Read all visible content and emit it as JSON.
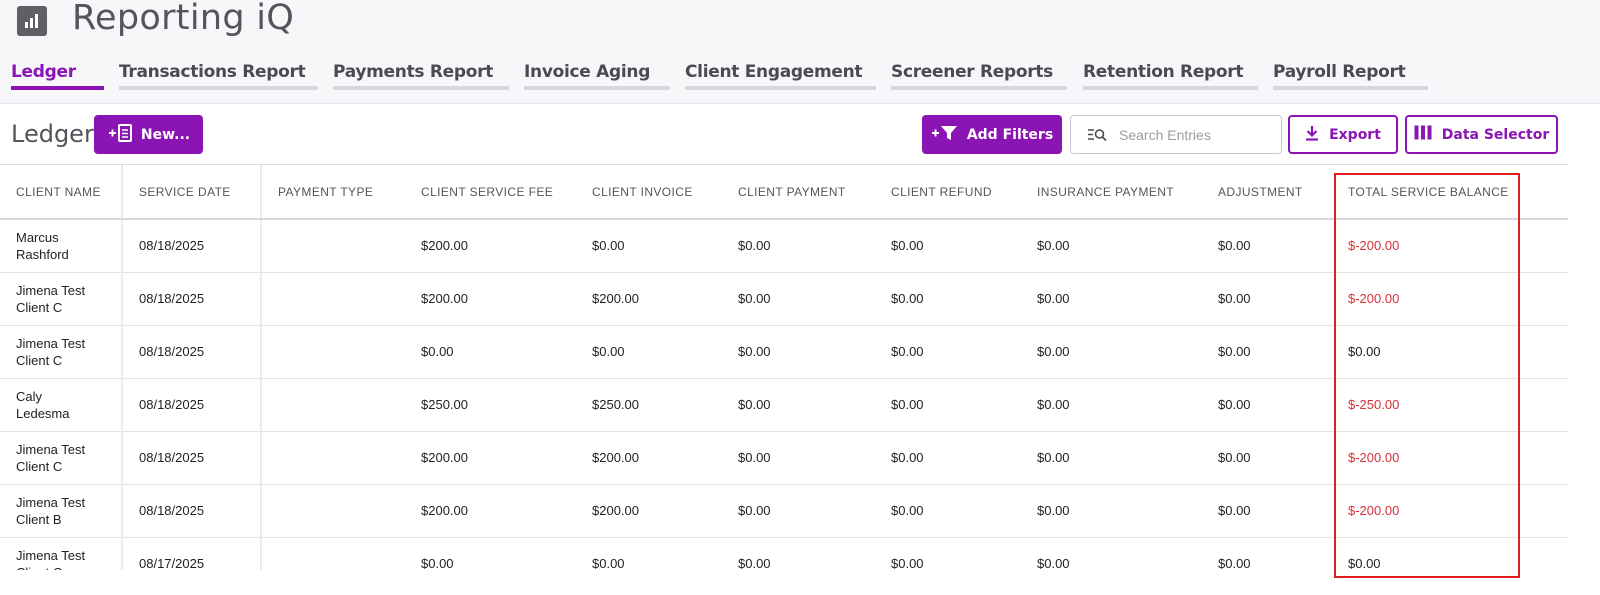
{
  "app": {
    "title": "Reporting iQ",
    "icon": "bar-chart-icon"
  },
  "tabs": [
    {
      "label": "Ledger",
      "active": true
    },
    {
      "label": "Transactions Report",
      "active": false
    },
    {
      "label": "Payments Report",
      "active": false
    },
    {
      "label": "Invoice Aging",
      "active": false
    },
    {
      "label": "Client Engagement",
      "active": false
    },
    {
      "label": "Screener Reports",
      "active": false
    },
    {
      "label": "Retention Report",
      "active": false
    },
    {
      "label": "Payroll Report",
      "active": false
    }
  ],
  "toolbar": {
    "title": "Ledger",
    "new_label": "New...",
    "new_icon": "plus-document-icon",
    "add_filters_label": "Add Filters",
    "add_filters_icon": "plus-filter-icon",
    "search_placeholder": "Search Entries",
    "search_value": "",
    "search_icon": "search-list-icon",
    "export_label": "Export",
    "export_icon": "download-icon",
    "data_selector_label": "Data Selector",
    "data_selector_icon": "columns-icon"
  },
  "table": {
    "columns": [
      "CLIENT NAME",
      "SERVICE DATE",
      "PAYMENT TYPE",
      "CLIENT SERVICE FEE",
      "CLIENT INVOICE",
      "CLIENT PAYMENT",
      "CLIENT REFUND",
      "INSURANCE PAYMENT",
      "ADJUSTMENT",
      "TOTAL SERVICE BALANCE"
    ],
    "rows": [
      {
        "client_line1": "Marcus",
        "client_line2": "Rashford",
        "service_date": "08/18/2025",
        "payment_type": "",
        "client_service_fee": "$200.00",
        "client_invoice": "$0.00",
        "client_payment": "$0.00",
        "client_refund": "$0.00",
        "insurance_payment": "$0.00",
        "adjustment": "$0.00",
        "total_service_balance": "$-200.00",
        "negative": true
      },
      {
        "client_line1": "Jimena Test",
        "client_line2": "Client C",
        "service_date": "08/18/2025",
        "payment_type": "",
        "client_service_fee": "$200.00",
        "client_invoice": "$200.00",
        "client_payment": "$0.00",
        "client_refund": "$0.00",
        "insurance_payment": "$0.00",
        "adjustment": "$0.00",
        "total_service_balance": "$-200.00",
        "negative": true
      },
      {
        "client_line1": "Jimena Test",
        "client_line2": "Client C",
        "service_date": "08/18/2025",
        "payment_type": "",
        "client_service_fee": "$0.00",
        "client_invoice": "$0.00",
        "client_payment": "$0.00",
        "client_refund": "$0.00",
        "insurance_payment": "$0.00",
        "adjustment": "$0.00",
        "total_service_balance": "$0.00",
        "negative": false
      },
      {
        "client_line1": "Caly",
        "client_line2": "Ledesma",
        "service_date": "08/18/2025",
        "payment_type": "",
        "client_service_fee": "$250.00",
        "client_invoice": "$250.00",
        "client_payment": "$0.00",
        "client_refund": "$0.00",
        "insurance_payment": "$0.00",
        "adjustment": "$0.00",
        "total_service_balance": "$-250.00",
        "negative": true
      },
      {
        "client_line1": "Jimena Test",
        "client_line2": "Client C",
        "service_date": "08/18/2025",
        "payment_type": "",
        "client_service_fee": "$200.00",
        "client_invoice": "$200.00",
        "client_payment": "$0.00",
        "client_refund": "$0.00",
        "insurance_payment": "$0.00",
        "adjustment": "$0.00",
        "total_service_balance": "$-200.00",
        "negative": true
      },
      {
        "client_line1": "Jimena Test",
        "client_line2": "Client B",
        "service_date": "08/18/2025",
        "payment_type": "",
        "client_service_fee": "$200.00",
        "client_invoice": "$200.00",
        "client_payment": "$0.00",
        "client_refund": "$0.00",
        "insurance_payment": "$0.00",
        "adjustment": "$0.00",
        "total_service_balance": "$-200.00",
        "negative": true
      },
      {
        "client_line1": "Jimena Test",
        "client_line2": "Client C",
        "service_date": "08/17/2025",
        "payment_type": "",
        "client_service_fee": "$0.00",
        "client_invoice": "$0.00",
        "client_payment": "$0.00",
        "client_refund": "$0.00",
        "insurance_payment": "$0.00",
        "adjustment": "$0.00",
        "total_service_balance": "$0.00",
        "negative": false
      }
    ]
  },
  "colors": {
    "accent": "#8a14b4",
    "negative": "#d9303b",
    "highlight_border": "#e01c1c"
  }
}
